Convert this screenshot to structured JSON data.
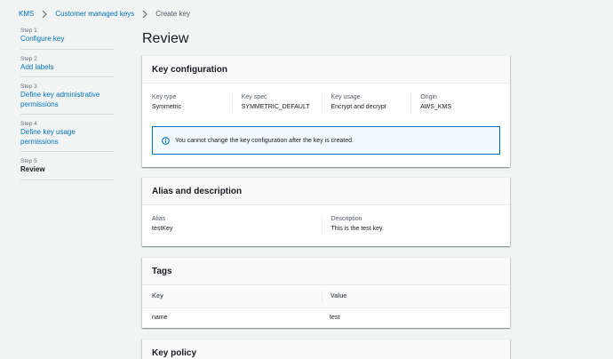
{
  "breadcrumb": [
    {
      "label": "KMS"
    },
    {
      "label": "Customer managed keys"
    },
    {
      "label": "Create key"
    }
  ],
  "steps": [
    {
      "num": "Step 1",
      "title": "Configure key"
    },
    {
      "num": "Step 2",
      "title": "Add labels"
    },
    {
      "num": "Step 3",
      "title": "Define key administrative permissions"
    },
    {
      "num": "Step 4",
      "title": "Define key usage permissions"
    },
    {
      "num": "Step 5",
      "title": "Review"
    }
  ],
  "page_title": "Review",
  "key_configuration": {
    "title": "Key configuration",
    "fields": [
      {
        "label": "Key type",
        "value": "Symmetric"
      },
      {
        "label": "Key spec",
        "value": "SYMMETRIC_DEFAULT"
      },
      {
        "label": "Key usage",
        "value": "Encrypt and decrypt"
      },
      {
        "label": "Origin",
        "value": "AWS_KMS"
      }
    ],
    "info": "You cannot change the key configuration after the key is created."
  },
  "alias_description": {
    "title": "Alias and description",
    "fields": [
      {
        "label": "Alias",
        "value": "testKey"
      },
      {
        "label": "Description",
        "value": "This is the test key."
      }
    ]
  },
  "tags": {
    "title": "Tags",
    "columns": [
      "Key",
      "Value"
    ],
    "rows": [
      {
        "key": "name",
        "value": "test"
      }
    ]
  },
  "key_policy": {
    "title": "Key policy"
  },
  "colors": {
    "link": "#0073bb",
    "info_border": "#0073bb",
    "info_bg": "#f1faff",
    "background": "#f2f3f3"
  }
}
